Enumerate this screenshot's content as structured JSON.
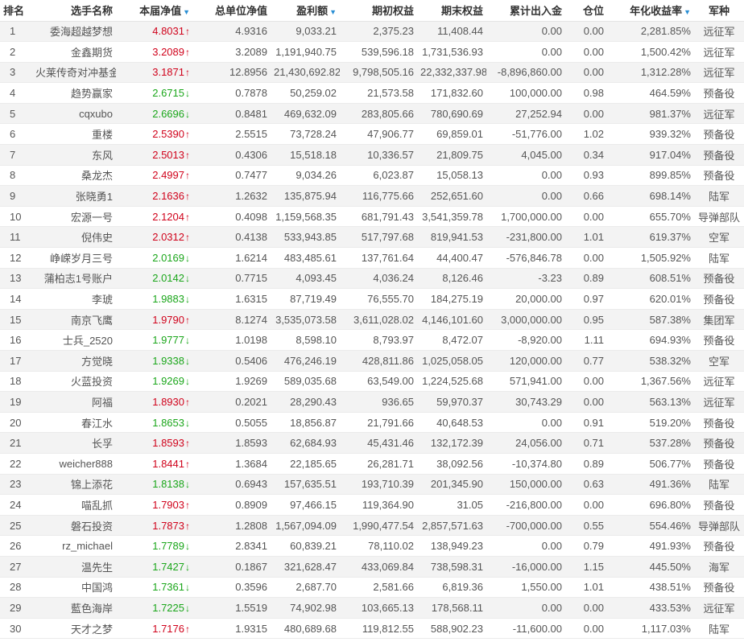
{
  "columns": {
    "rank": "排名",
    "name": "选手名称",
    "nav": "本届净值",
    "unit_nav": "总单位净值",
    "profit": "盈利额",
    "start_equity": "期初权益",
    "end_equity": "期末权益",
    "flow": "累计出入金",
    "position": "仓位",
    "annual_return": "年化收益率",
    "army": "军种"
  },
  "sort_icons": {
    "nav": "sort-desc-icon",
    "profit": "sort-desc-icon",
    "annual_return": "sort-desc-icon"
  },
  "colors": {
    "up": "#d0021b",
    "down": "#1aa61a",
    "sort_accent": "#2a8fd4"
  },
  "rows": [
    {
      "rank": "1",
      "name": "委海超越梦想",
      "nav": "4.8031",
      "dir": "up",
      "unit_nav": "4.9316",
      "profit": "9,033.21",
      "start_equity": "2,375.23",
      "end_equity": "11,408.44",
      "flow": "0.00",
      "position": "0.00",
      "annual_return": "2,281.85%",
      "army": "远征军"
    },
    {
      "rank": "2",
      "name": "金鑫期货",
      "nav": "3.2089",
      "dir": "up",
      "unit_nav": "3.2089",
      "profit": "1,191,940.75",
      "start_equity": "539,596.18",
      "end_equity": "1,731,536.93",
      "flow": "0.00",
      "position": "0.00",
      "annual_return": "1,500.42%",
      "army": "远征军"
    },
    {
      "rank": "3",
      "name": "火莱传奇对冲基金",
      "nav": "3.1871",
      "dir": "up",
      "unit_nav": "12.8956",
      "profit": "21,430,692.82",
      "start_equity": "9,798,505.16",
      "end_equity": "22,332,337.98",
      "flow": "-8,896,860.00",
      "position": "0.00",
      "annual_return": "1,312.28%",
      "army": "远征军"
    },
    {
      "rank": "4",
      "name": "趋势赢家",
      "nav": "2.6715",
      "dir": "down",
      "unit_nav": "0.7878",
      "profit": "50,259.02",
      "start_equity": "21,573.58",
      "end_equity": "171,832.60",
      "flow": "100,000.00",
      "position": "0.98",
      "annual_return": "464.59%",
      "army": "预备役"
    },
    {
      "rank": "5",
      "name": "cqxubo",
      "nav": "2.6696",
      "dir": "down",
      "unit_nav": "0.8481",
      "profit": "469,632.09",
      "start_equity": "283,805.66",
      "end_equity": "780,690.69",
      "flow": "27,252.94",
      "position": "0.00",
      "annual_return": "981.37%",
      "army": "远征军"
    },
    {
      "rank": "6",
      "name": "重楼",
      "nav": "2.5390",
      "dir": "up",
      "unit_nav": "2.5515",
      "profit": "73,728.24",
      "start_equity": "47,906.77",
      "end_equity": "69,859.01",
      "flow": "-51,776.00",
      "position": "1.02",
      "annual_return": "939.32%",
      "army": "预备役"
    },
    {
      "rank": "7",
      "name": "东风",
      "nav": "2.5013",
      "dir": "up",
      "unit_nav": "0.4306",
      "profit": "15,518.18",
      "start_equity": "10,336.57",
      "end_equity": "21,809.75",
      "flow": "4,045.00",
      "position": "0.34",
      "annual_return": "917.04%",
      "army": "预备役"
    },
    {
      "rank": "8",
      "name": "桑龙杰",
      "nav": "2.4997",
      "dir": "up",
      "unit_nav": "0.7477",
      "profit": "9,034.26",
      "start_equity": "6,023.87",
      "end_equity": "15,058.13",
      "flow": "0.00",
      "position": "0.93",
      "annual_return": "899.85%",
      "army": "预备役"
    },
    {
      "rank": "9",
      "name": "张晓勇1",
      "nav": "2.1636",
      "dir": "up",
      "unit_nav": "1.2632",
      "profit": "135,875.94",
      "start_equity": "116,775.66",
      "end_equity": "252,651.60",
      "flow": "0.00",
      "position": "0.66",
      "annual_return": "698.14%",
      "army": "陆军"
    },
    {
      "rank": "10",
      "name": "宏源一号",
      "nav": "2.1204",
      "dir": "up",
      "unit_nav": "0.4098",
      "profit": "1,159,568.35",
      "start_equity": "681,791.43",
      "end_equity": "3,541,359.78",
      "flow": "1,700,000.00",
      "position": "0.00",
      "annual_return": "655.70%",
      "army": "导弹部队"
    },
    {
      "rank": "11",
      "name": "倪伟史",
      "nav": "2.0312",
      "dir": "up",
      "unit_nav": "0.4138",
      "profit": "533,943.85",
      "start_equity": "517,797.68",
      "end_equity": "819,941.53",
      "flow": "-231,800.00",
      "position": "1.01",
      "annual_return": "619.37%",
      "army": "空军"
    },
    {
      "rank": "12",
      "name": "峥嵘岁月三号",
      "nav": "2.0169",
      "dir": "down",
      "unit_nav": "1.6214",
      "profit": "483,485.61",
      "start_equity": "137,761.64",
      "end_equity": "44,400.47",
      "flow": "-576,846.78",
      "position": "0.00",
      "annual_return": "1,505.92%",
      "army": "陆军"
    },
    {
      "rank": "13",
      "name": "蒲柏志1号账户",
      "nav": "2.0142",
      "dir": "down",
      "unit_nav": "0.7715",
      "profit": "4,093.45",
      "start_equity": "4,036.24",
      "end_equity": "8,126.46",
      "flow": "-3.23",
      "position": "0.89",
      "annual_return": "608.51%",
      "army": "预备役"
    },
    {
      "rank": "14",
      "name": "李琥",
      "nav": "1.9883",
      "dir": "down",
      "unit_nav": "1.6315",
      "profit": "87,719.49",
      "start_equity": "76,555.70",
      "end_equity": "184,275.19",
      "flow": "20,000.00",
      "position": "0.97",
      "annual_return": "620.01%",
      "army": "预备役"
    },
    {
      "rank": "15",
      "name": "南京飞鹰",
      "nav": "1.9790",
      "dir": "up",
      "unit_nav": "8.1274",
      "profit": "3,535,073.58",
      "start_equity": "3,611,028.02",
      "end_equity": "4,146,101.60",
      "flow": "3,000,000.00",
      "position": "0.95",
      "annual_return": "587.38%",
      "army": "集团军"
    },
    {
      "rank": "16",
      "name": "士兵_2520",
      "nav": "1.9777",
      "dir": "down",
      "unit_nav": "1.0198",
      "profit": "8,598.10",
      "start_equity": "8,793.97",
      "end_equity": "8,472.07",
      "flow": "-8,920.00",
      "position": "1.11",
      "annual_return": "694.93%",
      "army": "预备役"
    },
    {
      "rank": "17",
      "name": "方觉晓",
      "nav": "1.9338",
      "dir": "down",
      "unit_nav": "0.5406",
      "profit": "476,246.19",
      "start_equity": "428,811.86",
      "end_equity": "1,025,058.05",
      "flow": "120,000.00",
      "position": "0.77",
      "annual_return": "538.32%",
      "army": "空军"
    },
    {
      "rank": "18",
      "name": "火蓝投资",
      "nav": "1.9269",
      "dir": "down",
      "unit_nav": "1.9269",
      "profit": "589,035.68",
      "start_equity": "63,549.00",
      "end_equity": "1,224,525.68",
      "flow": "571,941.00",
      "position": "0.00",
      "annual_return": "1,367.56%",
      "army": "远征军"
    },
    {
      "rank": "19",
      "name": "阿福",
      "nav": "1.8930",
      "dir": "up",
      "unit_nav": "0.2021",
      "profit": "28,290.43",
      "start_equity": "936.65",
      "end_equity": "59,970.37",
      "flow": "30,743.29",
      "position": "0.00",
      "annual_return": "563.13%",
      "army": "远征军"
    },
    {
      "rank": "20",
      "name": "春江水",
      "nav": "1.8653",
      "dir": "down",
      "unit_nav": "0.5055",
      "profit": "18,856.87",
      "start_equity": "21,791.66",
      "end_equity": "40,648.53",
      "flow": "0.00",
      "position": "0.91",
      "annual_return": "519.20%",
      "army": "预备役"
    },
    {
      "rank": "21",
      "name": "长孚",
      "nav": "1.8593",
      "dir": "up",
      "unit_nav": "1.8593",
      "profit": "62,684.93",
      "start_equity": "45,431.46",
      "end_equity": "132,172.39",
      "flow": "24,056.00",
      "position": "0.71",
      "annual_return": "537.28%",
      "army": "预备役"
    },
    {
      "rank": "22",
      "name": "weicher888",
      "nav": "1.8441",
      "dir": "up",
      "unit_nav": "1.3684",
      "profit": "22,185.65",
      "start_equity": "26,281.71",
      "end_equity": "38,092.56",
      "flow": "-10,374.80",
      "position": "0.89",
      "annual_return": "506.77%",
      "army": "预备役"
    },
    {
      "rank": "23",
      "name": "锦上添花",
      "nav": "1.8138",
      "dir": "down",
      "unit_nav": "0.6943",
      "profit": "157,635.51",
      "start_equity": "193,710.39",
      "end_equity": "201,345.90",
      "flow": "150,000.00",
      "position": "0.63",
      "annual_return": "491.36%",
      "army": "陆军"
    },
    {
      "rank": "24",
      "name": "喵乱抓",
      "nav": "1.7903",
      "dir": "up",
      "unit_nav": "0.8909",
      "profit": "97,466.15",
      "start_equity": "119,364.90",
      "end_equity": "31.05",
      "flow": "-216,800.00",
      "position": "0.00",
      "annual_return": "696.80%",
      "army": "预备役"
    },
    {
      "rank": "25",
      "name": "磐石投资",
      "nav": "1.7873",
      "dir": "up",
      "unit_nav": "1.2808",
      "profit": "1,567,094.09",
      "start_equity": "1,990,477.54",
      "end_equity": "2,857,571.63",
      "flow": "-700,000.00",
      "position": "0.55",
      "annual_return": "554.46%",
      "army": "导弹部队"
    },
    {
      "rank": "26",
      "name": "rz_michael",
      "nav": "1.7789",
      "dir": "down",
      "unit_nav": "2.8341",
      "profit": "60,839.21",
      "start_equity": "78,110.02",
      "end_equity": "138,949.23",
      "flow": "0.00",
      "position": "0.79",
      "annual_return": "491.93%",
      "army": "预备役"
    },
    {
      "rank": "27",
      "name": "温先生",
      "nav": "1.7427",
      "dir": "down",
      "unit_nav": "0.1867",
      "profit": "321,628.47",
      "start_equity": "433,069.84",
      "end_equity": "738,598.31",
      "flow": "-16,000.00",
      "position": "1.15",
      "annual_return": "445.50%",
      "army": "海军"
    },
    {
      "rank": "28",
      "name": "中国鸿",
      "nav": "1.7361",
      "dir": "down",
      "unit_nav": "0.3596",
      "profit": "2,687.70",
      "start_equity": "2,581.66",
      "end_equity": "6,819.36",
      "flow": "1,550.00",
      "position": "1.01",
      "annual_return": "438.51%",
      "army": "预备役"
    },
    {
      "rank": "29",
      "name": "藍色海岸",
      "nav": "1.7225",
      "dir": "down",
      "unit_nav": "1.5519",
      "profit": "74,902.98",
      "start_equity": "103,665.13",
      "end_equity": "178,568.11",
      "flow": "0.00",
      "position": "0.00",
      "annual_return": "433.53%",
      "army": "远征军"
    },
    {
      "rank": "30",
      "name": "天才之梦",
      "nav": "1.7176",
      "dir": "up",
      "unit_nav": "1.9315",
      "profit": "480,689.68",
      "start_equity": "119,812.55",
      "end_equity": "588,902.23",
      "flow": "-11,600.00",
      "position": "0.00",
      "annual_return": "1,117.03%",
      "army": "陆军"
    }
  ]
}
